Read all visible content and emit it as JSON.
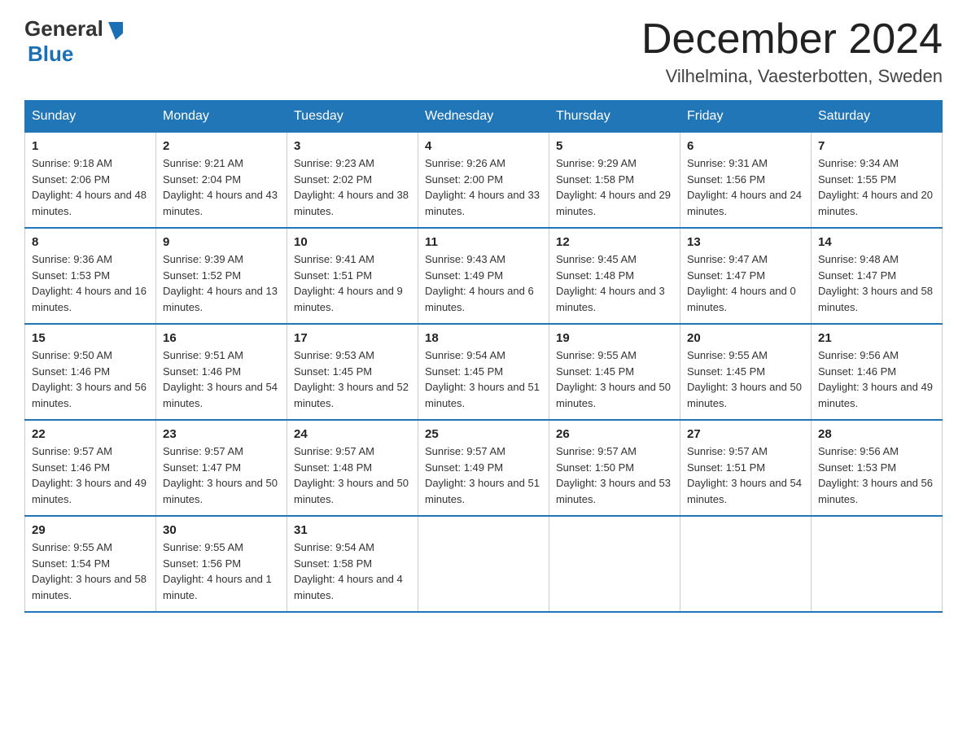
{
  "header": {
    "logo_general": "General",
    "logo_blue": "Blue",
    "month_title": "December 2024",
    "location": "Vilhelmina, Vaesterbotten, Sweden"
  },
  "weekdays": [
    "Sunday",
    "Monday",
    "Tuesday",
    "Wednesday",
    "Thursday",
    "Friday",
    "Saturday"
  ],
  "weeks": [
    [
      {
        "day": "1",
        "sunrise": "9:18 AM",
        "sunset": "2:06 PM",
        "daylight": "4 hours and 48 minutes."
      },
      {
        "day": "2",
        "sunrise": "9:21 AM",
        "sunset": "2:04 PM",
        "daylight": "4 hours and 43 minutes."
      },
      {
        "day": "3",
        "sunrise": "9:23 AM",
        "sunset": "2:02 PM",
        "daylight": "4 hours and 38 minutes."
      },
      {
        "day": "4",
        "sunrise": "9:26 AM",
        "sunset": "2:00 PM",
        "daylight": "4 hours and 33 minutes."
      },
      {
        "day": "5",
        "sunrise": "9:29 AM",
        "sunset": "1:58 PM",
        "daylight": "4 hours and 29 minutes."
      },
      {
        "day": "6",
        "sunrise": "9:31 AM",
        "sunset": "1:56 PM",
        "daylight": "4 hours and 24 minutes."
      },
      {
        "day": "7",
        "sunrise": "9:34 AM",
        "sunset": "1:55 PM",
        "daylight": "4 hours and 20 minutes."
      }
    ],
    [
      {
        "day": "8",
        "sunrise": "9:36 AM",
        "sunset": "1:53 PM",
        "daylight": "4 hours and 16 minutes."
      },
      {
        "day": "9",
        "sunrise": "9:39 AM",
        "sunset": "1:52 PM",
        "daylight": "4 hours and 13 minutes."
      },
      {
        "day": "10",
        "sunrise": "9:41 AM",
        "sunset": "1:51 PM",
        "daylight": "4 hours and 9 minutes."
      },
      {
        "day": "11",
        "sunrise": "9:43 AM",
        "sunset": "1:49 PM",
        "daylight": "4 hours and 6 minutes."
      },
      {
        "day": "12",
        "sunrise": "9:45 AM",
        "sunset": "1:48 PM",
        "daylight": "4 hours and 3 minutes."
      },
      {
        "day": "13",
        "sunrise": "9:47 AM",
        "sunset": "1:47 PM",
        "daylight": "4 hours and 0 minutes."
      },
      {
        "day": "14",
        "sunrise": "9:48 AM",
        "sunset": "1:47 PM",
        "daylight": "3 hours and 58 minutes."
      }
    ],
    [
      {
        "day": "15",
        "sunrise": "9:50 AM",
        "sunset": "1:46 PM",
        "daylight": "3 hours and 56 minutes."
      },
      {
        "day": "16",
        "sunrise": "9:51 AM",
        "sunset": "1:46 PM",
        "daylight": "3 hours and 54 minutes."
      },
      {
        "day": "17",
        "sunrise": "9:53 AM",
        "sunset": "1:45 PM",
        "daylight": "3 hours and 52 minutes."
      },
      {
        "day": "18",
        "sunrise": "9:54 AM",
        "sunset": "1:45 PM",
        "daylight": "3 hours and 51 minutes."
      },
      {
        "day": "19",
        "sunrise": "9:55 AM",
        "sunset": "1:45 PM",
        "daylight": "3 hours and 50 minutes."
      },
      {
        "day": "20",
        "sunrise": "9:55 AM",
        "sunset": "1:45 PM",
        "daylight": "3 hours and 50 minutes."
      },
      {
        "day": "21",
        "sunrise": "9:56 AM",
        "sunset": "1:46 PM",
        "daylight": "3 hours and 49 minutes."
      }
    ],
    [
      {
        "day": "22",
        "sunrise": "9:57 AM",
        "sunset": "1:46 PM",
        "daylight": "3 hours and 49 minutes."
      },
      {
        "day": "23",
        "sunrise": "9:57 AM",
        "sunset": "1:47 PM",
        "daylight": "3 hours and 50 minutes."
      },
      {
        "day": "24",
        "sunrise": "9:57 AM",
        "sunset": "1:48 PM",
        "daylight": "3 hours and 50 minutes."
      },
      {
        "day": "25",
        "sunrise": "9:57 AM",
        "sunset": "1:49 PM",
        "daylight": "3 hours and 51 minutes."
      },
      {
        "day": "26",
        "sunrise": "9:57 AM",
        "sunset": "1:50 PM",
        "daylight": "3 hours and 53 minutes."
      },
      {
        "day": "27",
        "sunrise": "9:57 AM",
        "sunset": "1:51 PM",
        "daylight": "3 hours and 54 minutes."
      },
      {
        "day": "28",
        "sunrise": "9:56 AM",
        "sunset": "1:53 PM",
        "daylight": "3 hours and 56 minutes."
      }
    ],
    [
      {
        "day": "29",
        "sunrise": "9:55 AM",
        "sunset": "1:54 PM",
        "daylight": "3 hours and 58 minutes."
      },
      {
        "day": "30",
        "sunrise": "9:55 AM",
        "sunset": "1:56 PM",
        "daylight": "4 hours and 1 minute."
      },
      {
        "day": "31",
        "sunrise": "9:54 AM",
        "sunset": "1:58 PM",
        "daylight": "4 hours and 4 minutes."
      },
      null,
      null,
      null,
      null
    ]
  ]
}
